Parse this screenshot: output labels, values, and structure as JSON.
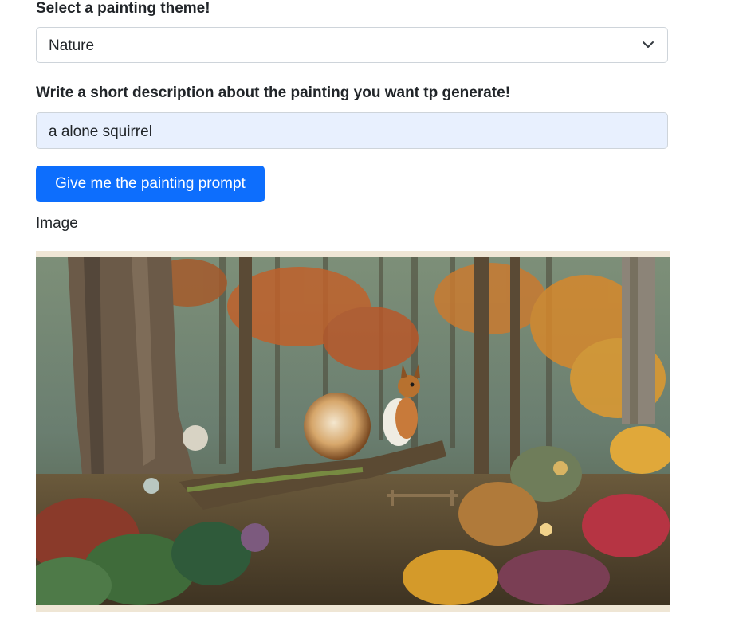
{
  "form": {
    "theme_label": "Select a painting theme!",
    "theme_value": "Nature",
    "description_label": "Write a short description about the painting you want tp generate!",
    "description_value": "a alone squirrel",
    "submit_label": "Give me the painting prompt"
  },
  "result": {
    "image_caption": "Image"
  },
  "colors": {
    "button": "#0d6efd",
    "input_autofill": "#e8f0fe",
    "border": "#ced4da"
  },
  "icons": {
    "select_caret": "chevron-down-icon"
  }
}
